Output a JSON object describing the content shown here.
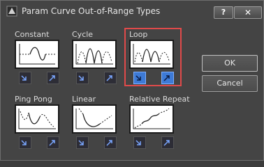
{
  "window": {
    "title": "Param Curve Out-of-Range Types"
  },
  "titlebar": {
    "help_label": "?",
    "close_label": "✕"
  },
  "options": [
    {
      "label": "Constant"
    },
    {
      "label": "Cycle"
    },
    {
      "label": "Loop",
      "selected": true
    },
    {
      "label": "Ping Pong"
    },
    {
      "label": "Linear"
    },
    {
      "label": "Relative Repeat"
    }
  ],
  "buttons": {
    "ok": "OK",
    "cancel": "Cancel"
  },
  "colors": {
    "selection_outline": "#e04a4a",
    "selected_toggle": "#3d7ad6"
  }
}
